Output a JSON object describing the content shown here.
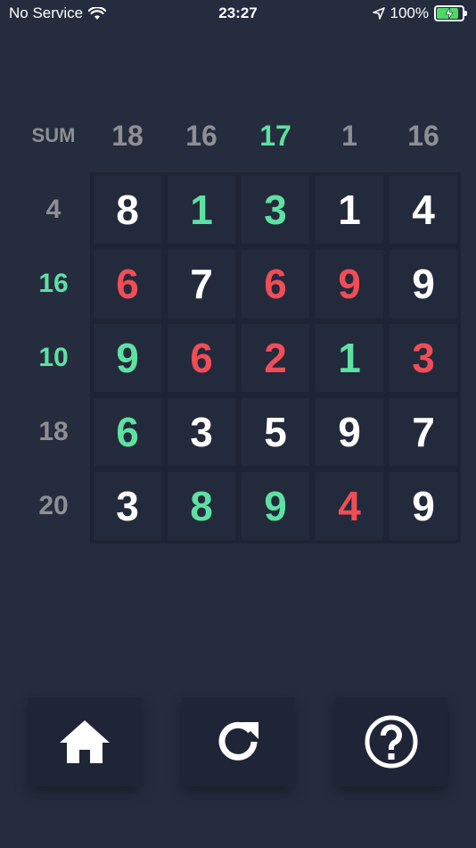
{
  "status_bar": {
    "carrier": "No Service",
    "time": "23:27",
    "battery": "100%",
    "battery_level": 1.0
  },
  "colors": {
    "background": "#252c3e",
    "grid_bg": "#1e2434",
    "cell_bg": "#232a3b",
    "neutral": "#ffffff",
    "green": "#5ee0a2",
    "red": "#f04d57",
    "gray": "#8e8f93"
  },
  "sum_label": "SUM",
  "column_sums": [
    {
      "value": "18",
      "state": "gray"
    },
    {
      "value": "16",
      "state": "gray"
    },
    {
      "value": "17",
      "state": "green"
    },
    {
      "value": "1",
      "state": "gray"
    },
    {
      "value": "16",
      "state": "gray"
    }
  ],
  "row_sums": [
    {
      "value": "4",
      "state": "gray"
    },
    {
      "value": "16",
      "state": "green"
    },
    {
      "value": "10",
      "state": "green"
    },
    {
      "value": "18",
      "state": "gray"
    },
    {
      "value": "20",
      "state": "gray"
    }
  ],
  "grid": [
    [
      {
        "v": "8",
        "s": "neutral"
      },
      {
        "v": "1",
        "s": "green"
      },
      {
        "v": "3",
        "s": "green"
      },
      {
        "v": "1",
        "s": "neutral"
      },
      {
        "v": "4",
        "s": "neutral"
      }
    ],
    [
      {
        "v": "6",
        "s": "red"
      },
      {
        "v": "7",
        "s": "neutral"
      },
      {
        "v": "6",
        "s": "red"
      },
      {
        "v": "9",
        "s": "red"
      },
      {
        "v": "9",
        "s": "neutral"
      }
    ],
    [
      {
        "v": "9",
        "s": "green"
      },
      {
        "v": "6",
        "s": "red"
      },
      {
        "v": "2",
        "s": "red"
      },
      {
        "v": "1",
        "s": "green"
      },
      {
        "v": "3",
        "s": "red"
      }
    ],
    [
      {
        "v": "6",
        "s": "green"
      },
      {
        "v": "3",
        "s": "neutral"
      },
      {
        "v": "5",
        "s": "neutral"
      },
      {
        "v": "9",
        "s": "neutral"
      },
      {
        "v": "7",
        "s": "neutral"
      }
    ],
    [
      {
        "v": "3",
        "s": "neutral"
      },
      {
        "v": "8",
        "s": "green"
      },
      {
        "v": "9",
        "s": "green"
      },
      {
        "v": "4",
        "s": "red"
      },
      {
        "v": "9",
        "s": "neutral"
      }
    ]
  ],
  "buttons": [
    {
      "icon": "home-icon"
    },
    {
      "icon": "refresh-icon"
    },
    {
      "icon": "help-icon"
    }
  ]
}
